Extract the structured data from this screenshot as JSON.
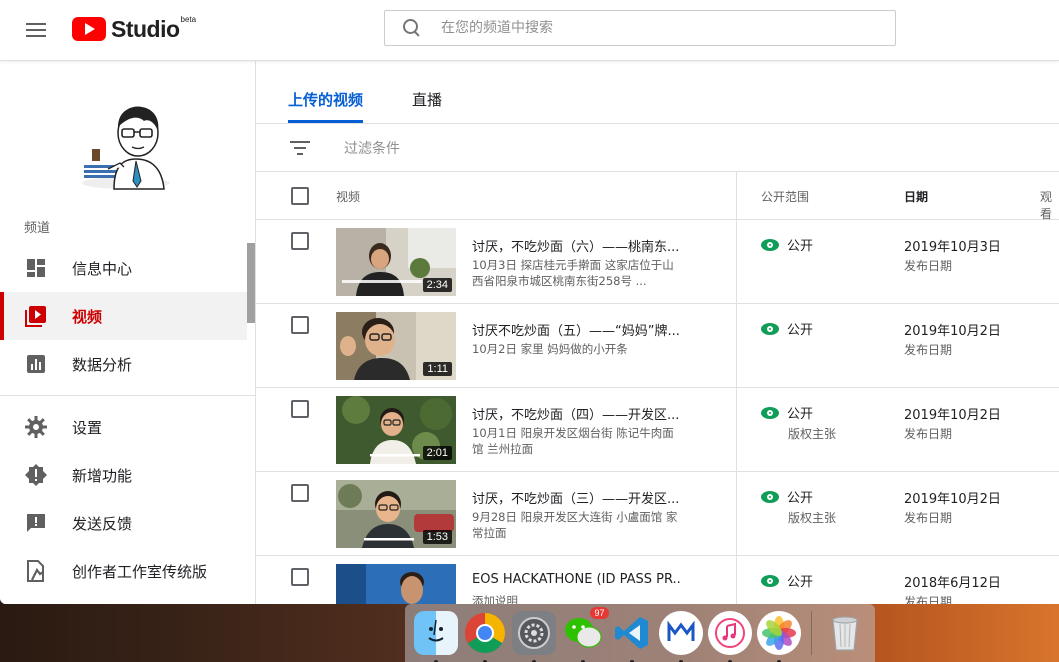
{
  "header": {
    "logo_text": "Studio",
    "logo_beta": "beta",
    "search_placeholder": "在您的频道中搜索"
  },
  "sidebar": {
    "channel_label": "频道",
    "items": [
      {
        "label": "信息中心",
        "icon": "dashboard-icon"
      },
      {
        "label": "视频",
        "icon": "video-icon",
        "active": true
      },
      {
        "label": "数据分析",
        "icon": "analytics-icon"
      },
      {
        "label": "设置",
        "icon": "gear-icon"
      },
      {
        "label": "新增功能",
        "icon": "whats-new-icon"
      },
      {
        "label": "发送反馈",
        "icon": "feedback-icon"
      },
      {
        "label": "创作者工作室传统版",
        "icon": "classic-studio-icon"
      }
    ]
  },
  "tabs": [
    {
      "label": "上传的视频",
      "active": true
    },
    {
      "label": "直播"
    }
  ],
  "filter": {
    "placeholder": "过滤条件"
  },
  "table": {
    "headers": {
      "video": "视频",
      "visibility": "公开范围",
      "date": "日期",
      "views": "观看"
    },
    "rows": [
      {
        "title": "讨厌，不吃炒面（六）——桃南东...",
        "description": "10月3日 探店桂元手擀面 这家店位于山西省阳泉市城区桃南东街258号 ...",
        "duration": "2:34",
        "visibility": "公开",
        "visibility_sub": "",
        "date": "2019年10月3日",
        "date_sub": "发布日期"
      },
      {
        "title": "讨厌不吃炒面（五）——“妈妈”牌...",
        "description": "10月2日 家里 妈妈做的小开条",
        "duration": "1:11",
        "visibility": "公开",
        "visibility_sub": "",
        "date": "2019年10月2日",
        "date_sub": "发布日期"
      },
      {
        "title": "讨厌，不吃炒面（四）——开发区...",
        "description": "10月1日 阳泉开发区烟台街 陈记牛肉面馆 兰州拉面",
        "duration": "2:01",
        "visibility": "公开",
        "visibility_sub": "版权主张",
        "date": "2019年10月2日",
        "date_sub": "发布日期"
      },
      {
        "title": "讨厌，不吃炒面（三）——开发区...",
        "description": "9月28日 阳泉开发区大连街 小盧面馆 家常拉面",
        "duration": "1:53",
        "visibility": "公开",
        "visibility_sub": "版权主张",
        "date": "2019年10月2日",
        "date_sub": "发布日期"
      },
      {
        "title": "EOS HACKATHONE (ID PASS PR...",
        "description": "添加说明",
        "duration": "",
        "visibility": "公开",
        "visibility_sub": "",
        "date": "2018年6月12日",
        "date_sub": "发布日期"
      }
    ]
  },
  "dock": {
    "wechat_badge": "97",
    "apps": [
      "finder-icon",
      "chrome-icon",
      "system-preferences-icon",
      "wechat-icon",
      "vscode-icon",
      "meta-app-icon",
      "music-icon",
      "photos-icon",
      "trash-icon"
    ]
  }
}
